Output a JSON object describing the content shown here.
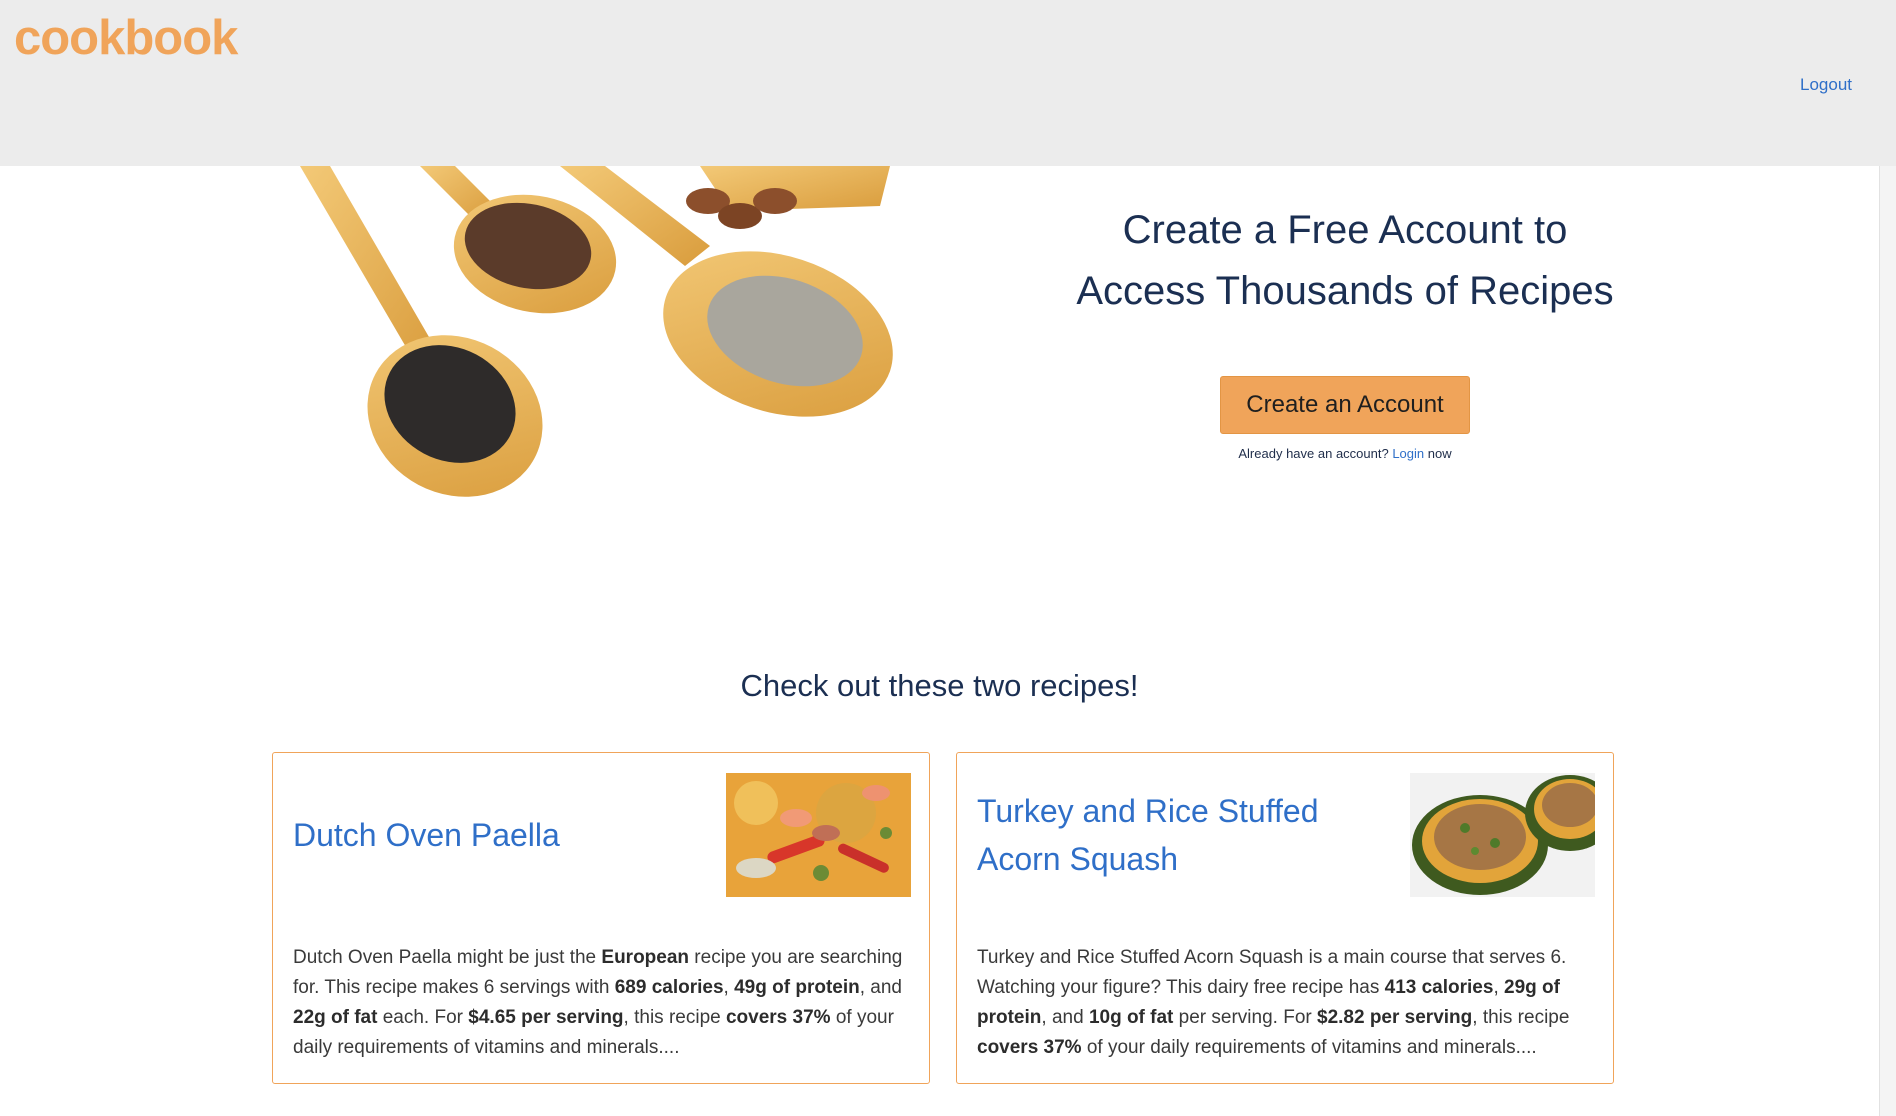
{
  "header": {
    "logo": "cookbook",
    "logout_label": "Logout"
  },
  "hero": {
    "title_line1": "Create a Free Account to",
    "title_line2": "Access Thousands of Recipes",
    "cta_label": "Create an Account",
    "login_prefix": "Already have an account?",
    "login_link": "Login",
    "login_suffix": "now"
  },
  "section": {
    "title": "Check out these two recipes!"
  },
  "recipes": [
    {
      "title": "Dutch Oven Paella",
      "desc": [
        "Dutch Oven Paella might be just the ",
        "European",
        " recipe you are searching for. This recipe makes 6 servings with ",
        "689 calories",
        ", ",
        "49g of protein",
        ", and ",
        "22g of fat",
        " each. For ",
        "$4.65 per serving",
        ", this recipe ",
        "covers 37%",
        " of your daily requirements of vitamins and minerals...."
      ]
    },
    {
      "title": "Turkey and Rice Stuffed Acorn Squash",
      "desc": [
        "Turkey and Rice Stuffed Acorn Squash is a main course that serves 6. Watching your figure? This dairy free recipe has ",
        "413 calories",
        ", ",
        "29g of protein",
        ", and ",
        "10g of fat",
        " per serving. For ",
        "$2.82 per serving",
        ", this recipe ",
        "covers 37%",
        " of your daily requirements of vitamins and minerals...."
      ]
    }
  ],
  "colors": {
    "accent": "#f0a45a",
    "link": "#2f6fc8",
    "heading": "#1b2f52",
    "header_bg": "#ececec"
  },
  "icons": {
    "hero_image": "wooden-spoons-with-seeds-image",
    "recipe1_image": "paella-dish-image",
    "recipe2_image": "stuffed-acorn-squash-image"
  }
}
